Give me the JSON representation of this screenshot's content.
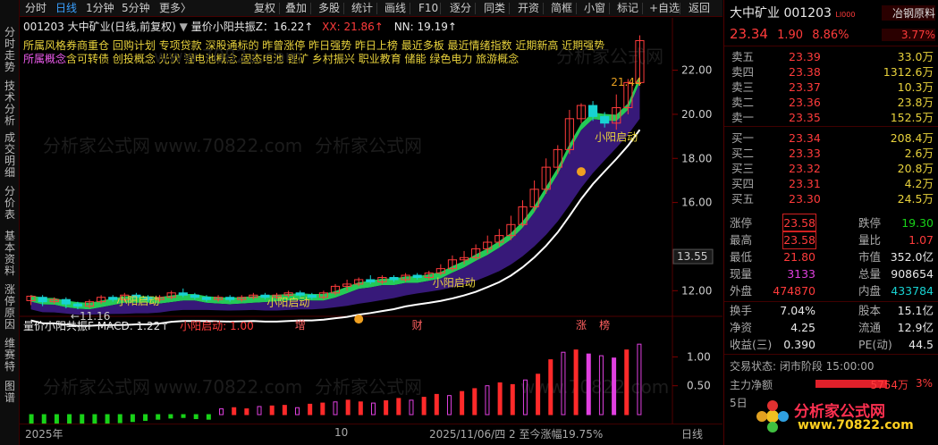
{
  "side_tabs": [
    "分时走势",
    "技术分析",
    "成交明细",
    "分价表",
    "基本资料",
    "涨停原因",
    "维赛特",
    "图谱"
  ],
  "toolbar": {
    "left_items": [
      "分时",
      "日线",
      "1分钟",
      "5分钟",
      "更多〉"
    ],
    "right_items": [
      "复权",
      "叠加",
      "多股",
      "统计",
      "画线",
      "F10",
      "逐分",
      "同类",
      "开资",
      "简框",
      "小窗",
      "标记",
      "+自选",
      "返回"
    ]
  },
  "chart_header": {
    "code_name": "001203 大中矿业(日线,前复权)",
    "indicator": "量价小阳共振Z：16.22↑",
    "xx": "XX: 21.86↑",
    "nn": "NN: 19.19↑"
  },
  "tags": {
    "row1_label": "所属风格",
    "row1": "券商重仓 回购计划 专项贷款 深股通标的 昨曾涨停 昨日强势 昨日上榜 最近多板 最近情绪指数 近期新高 近期强势",
    "row2_label": "所属概念",
    "row2": "含可转债 创投概念 光伏 锂电池概念 固态电池 锂矿 乡村振兴 职业教育 储能 绿色电力 旅游概念"
  },
  "price_axis": {
    "labels": [
      "22.00",
      "20.00",
      "18.00",
      "16.00",
      "12.00"
    ],
    "current_label": "13.55"
  },
  "annotations": {
    "low": "11.16",
    "high_label": "21.44",
    "signal": "小阳启动",
    "markers": [
      "增",
      "财",
      "涨",
      "榜"
    ]
  },
  "macd_header": {
    "name": "量价小阳共振F MACD: 1.22↑",
    "signal": "小阳启动: 1.00"
  },
  "macd_axis": {
    "labels": [
      "1.00",
      "0.50"
    ]
  },
  "bottom_axis": {
    "year": "2025年",
    "month": "10",
    "info": "2025/11/06/四 2 至今涨幅19.75%",
    "period": "日线"
  },
  "chart_data": {
    "type": "candlestick",
    "dates_note": "daily candles, 2025",
    "ylim": [
      11.0,
      23.4
    ],
    "candles": [
      [
        11.55,
        11.75,
        11.35,
        11.8
      ],
      [
        11.7,
        11.5,
        11.3,
        11.8
      ],
      [
        11.5,
        11.6,
        11.4,
        11.7
      ],
      [
        11.6,
        11.4,
        11.2,
        11.7
      ],
      [
        11.4,
        11.3,
        11.16,
        11.5
      ],
      [
        11.3,
        11.5,
        11.2,
        11.6
      ],
      [
        11.5,
        11.7,
        11.4,
        11.8
      ],
      [
        11.7,
        11.6,
        11.5,
        11.8
      ],
      [
        11.6,
        11.8,
        11.5,
        11.9
      ],
      [
        11.8,
        11.7,
        11.6,
        11.9
      ],
      [
        11.7,
        11.6,
        11.5,
        11.8
      ],
      [
        11.6,
        11.7,
        11.5,
        11.8
      ],
      [
        11.7,
        11.9,
        11.6,
        12.0
      ],
      [
        11.9,
        11.8,
        11.7,
        12.1
      ],
      [
        11.8,
        11.7,
        11.6,
        11.9
      ],
      [
        11.7,
        11.6,
        11.5,
        11.8
      ],
      [
        11.6,
        11.7,
        11.5,
        11.8
      ],
      [
        11.7,
        11.6,
        11.5,
        11.8
      ],
      [
        11.6,
        11.7,
        11.5,
        11.8
      ],
      [
        11.7,
        11.8,
        11.6,
        11.9
      ],
      [
        11.8,
        11.7,
        11.6,
        11.9
      ],
      [
        11.7,
        11.8,
        11.6,
        11.9
      ],
      [
        11.8,
        11.9,
        11.7,
        12.0
      ],
      [
        11.9,
        11.8,
        11.7,
        12.0
      ],
      [
        11.8,
        11.7,
        11.6,
        11.9
      ],
      [
        11.7,
        11.9,
        11.6,
        12.0
      ],
      [
        11.9,
        12.2,
        11.8,
        12.3
      ],
      [
        12.2,
        12.3,
        12.0,
        12.5
      ],
      [
        12.3,
        12.5,
        12.2,
        12.6
      ],
      [
        12.5,
        12.4,
        12.3,
        12.7
      ],
      [
        12.4,
        12.6,
        12.3,
        12.7
      ],
      [
        12.6,
        12.5,
        12.4,
        12.7
      ],
      [
        12.5,
        12.7,
        12.4,
        12.8
      ],
      [
        12.7,
        12.6,
        12.5,
        12.8
      ],
      [
        12.6,
        12.8,
        12.5,
        12.9
      ],
      [
        12.8,
        13.0,
        12.7,
        13.2
      ],
      [
        13.0,
        13.4,
        12.9,
        13.6
      ],
      [
        13.4,
        13.5,
        13.2,
        13.8
      ],
      [
        13.5,
        13.9,
        13.4,
        14.1
      ],
      [
        13.9,
        14.2,
        13.7,
        14.5
      ],
      [
        14.2,
        14.5,
        14.0,
        14.8
      ],
      [
        14.5,
        15.0,
        14.3,
        15.4
      ],
      [
        15.0,
        15.8,
        14.9,
        16.1
      ],
      [
        15.8,
        16.6,
        15.6,
        17.0
      ],
      [
        16.6,
        17.6,
        16.4,
        18.0
      ],
      [
        17.6,
        18.4,
        17.3,
        18.6
      ],
      [
        18.4,
        19.8,
        18.2,
        20.2
      ],
      [
        19.8,
        20.4,
        19.6,
        20.5
      ],
      [
        20.4,
        19.9,
        19.7,
        20.6
      ],
      [
        19.9,
        19.6,
        19.4,
        20.1
      ],
      [
        19.6,
        20.3,
        19.3,
        20.9
      ],
      [
        20.3,
        21.44,
        20.0,
        21.6
      ],
      [
        21.44,
        23.34,
        21.3,
        23.58
      ]
    ],
    "macd": [
      -0.25,
      -0.22,
      -0.2,
      -0.18,
      -0.15,
      -0.16,
      -0.17,
      -0.14,
      -0.12,
      -0.1,
      -0.08,
      -0.06,
      -0.05,
      -0.07,
      -0.08,
      0.1,
      0.12,
      0.1,
      0.14,
      0.15,
      0.16,
      0.12,
      0.18,
      0.2,
      0.22,
      0.25,
      0.22,
      0.2,
      0.24,
      0.28,
      0.25,
      0.3,
      0.35,
      0.33,
      0.4,
      0.45,
      0.5,
      0.55,
      0.52,
      0.6,
      0.7,
      0.95,
      1.08,
      1.12,
      1.05,
      1.02,
      0.98,
      1.12,
      1.22
    ]
  },
  "quote": {
    "name": "大中矿业",
    "code": "001203",
    "badge": "LI000",
    "tag": "冶钢原料",
    "price": "23.34",
    "change": "1.90",
    "change_pct": "8.86%",
    "tag_pct": "3.77%",
    "asks": [
      [
        "卖五",
        "23.39",
        "33.0万"
      ],
      [
        "卖四",
        "23.38",
        "1312.6万"
      ],
      [
        "卖三",
        "23.37",
        "10.3万"
      ],
      [
        "卖二",
        "23.36",
        "23.8万"
      ],
      [
        "卖一",
        "23.35",
        "152.5万"
      ]
    ],
    "bids": [
      [
        "买一",
        "23.34",
        "208.4万"
      ],
      [
        "买二",
        "23.33",
        "2.6万"
      ],
      [
        "买三",
        "23.32",
        "20.8万"
      ],
      [
        "买四",
        "23.31",
        "4.2万"
      ],
      [
        "买五",
        "23.30",
        "24.5万"
      ]
    ],
    "stats": [
      [
        "涨停",
        "23.58",
        "跌停",
        "19.30"
      ],
      [
        "最高",
        "23.58",
        "量比",
        "1.07"
      ],
      [
        "最低",
        "21.80",
        "市值",
        "352.0亿"
      ],
      [
        "现量",
        "3133",
        "总量",
        "908654"
      ],
      [
        "外盘",
        "474870",
        "内盘",
        "433784"
      ]
    ],
    "stats2": [
      [
        "换手",
        "7.04%",
        "股本",
        "15.1亿"
      ],
      [
        "净资",
        "4.25",
        "流通",
        "12.9亿"
      ],
      [
        "收益(三)",
        "0.390",
        "PE(动)",
        "44.5"
      ]
    ],
    "trade_status": "交易状态: 闭市阶段 15:00:00",
    "main_flow_label": "主力净额",
    "main_flow_value": "5754万",
    "main_flow_pct": "3%",
    "day_label": "5日",
    "logo_text": "分析家公式网",
    "logo_url": "www.70822.com"
  }
}
